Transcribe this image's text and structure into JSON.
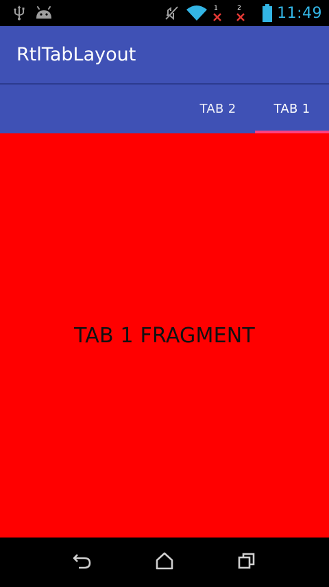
{
  "status_bar": {
    "time": "11:49",
    "sim1_label": "1",
    "sim2_label": "2",
    "icons": [
      "usb-icon",
      "android-debug-icon",
      "mute-icon",
      "wifi-icon",
      "sim1-no-signal-icon",
      "sim2-no-signal-icon",
      "battery-icon"
    ],
    "time_color": "#33b5e5"
  },
  "app_bar": {
    "title": "RtlTabLayout",
    "color": "#3f51b5"
  },
  "tabs": [
    {
      "label": "TAB 2",
      "selected": false
    },
    {
      "label": "TAB 1",
      "selected": true
    }
  ],
  "tab_indicator_color": "#ff4081",
  "fragment": {
    "text": "TAB 1 FRAGMENT",
    "background": "#ff0000"
  },
  "nav_bar": {
    "buttons": [
      "back-icon",
      "home-icon",
      "recents-icon"
    ]
  }
}
